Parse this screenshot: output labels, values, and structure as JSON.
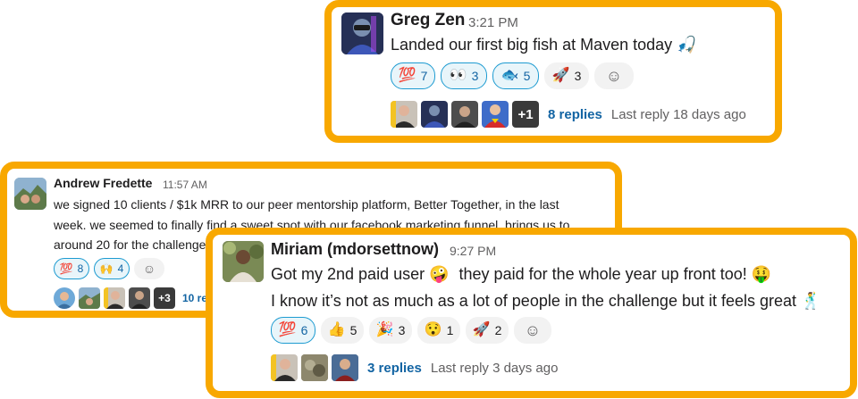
{
  "greg": {
    "name": "Greg Zen",
    "time": "3:21 PM",
    "message": "Landed our first big fish at Maven today 🎣",
    "reactions": [
      {
        "emoji": "💯",
        "count": "7"
      },
      {
        "emoji": "👀",
        "count": "3"
      },
      {
        "emoji": "🐟",
        "count": "5"
      },
      {
        "emoji": "🚀",
        "count": "3"
      }
    ],
    "add_reaction": "☺",
    "more_participants": "+1",
    "replies": "8 replies",
    "last_reply": "Last reply 18 days ago"
  },
  "andrew": {
    "name": "Andrew Fredette",
    "time": "11:57 AM",
    "message_line1": "we signed 10 clients / $1k MRR to our peer mentorship platform, Better Together, in the last",
    "message_line2": "week. we seemed to finally find a sweet spot with our facebook marketing funnel. brings us to",
    "message_line3": "around 20 for the challenge",
    "reactions": [
      {
        "emoji": "💯",
        "count": "8"
      },
      {
        "emoji": "🙌",
        "count": "4"
      }
    ],
    "add_reaction": "☺",
    "more_participants": "+3",
    "replies": "10 re"
  },
  "miriam": {
    "name": "Miriam (mdorsettnow)",
    "time": "9:27 PM",
    "message_line1_a": "Got my 2nd paid user 🤪",
    "message_line1_b": "they paid for the whole year up front too! 🤑",
    "message_line2": "I know it’s not as much as a lot of people in the challenge but it feels great 🕺",
    "reactions": [
      {
        "emoji": "💯",
        "count": "6"
      },
      {
        "emoji": "👍",
        "count": "5"
      },
      {
        "emoji": "🎉",
        "count": "3"
      },
      {
        "emoji": "😯",
        "count": "1"
      },
      {
        "emoji": "🚀",
        "count": "2"
      }
    ],
    "add_reaction": "☺",
    "replies": "3 replies",
    "last_reply": "Last reply 3 days ago"
  },
  "colors": {
    "highlight_border": "#f8a800",
    "link": "#1264a3",
    "active_reaction_bg": "#e8f5fa",
    "active_reaction_border": "#1d9bd1"
  }
}
